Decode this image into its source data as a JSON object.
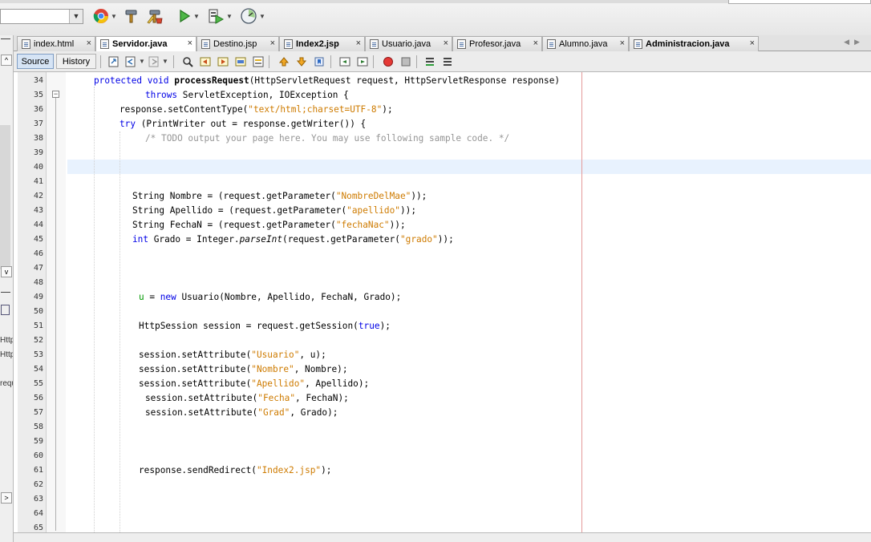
{
  "toolbar": {
    "icons": [
      "chrome-icon",
      "hammer-icon",
      "clean-build-icon",
      "run-icon",
      "debug-icon",
      "profile-icon"
    ]
  },
  "tabs": [
    {
      "label": "index.html",
      "bold": false,
      "active": false
    },
    {
      "label": "Servidor.java",
      "bold": true,
      "active": true
    },
    {
      "label": "Destino.jsp",
      "bold": false,
      "active": false
    },
    {
      "label": "Index2.jsp",
      "bold": true,
      "active": false
    },
    {
      "label": "Usuario.java",
      "bold": false,
      "active": false
    },
    {
      "label": "Profesor.java",
      "bold": false,
      "active": false
    },
    {
      "label": "Alumno.java",
      "bold": false,
      "active": false
    },
    {
      "label": "Administracion.java",
      "bold": true,
      "active": false
    }
  ],
  "tab_close": "×",
  "editor": {
    "source_label": "Source",
    "history_label": "History"
  },
  "left_fragments": [
    "Http",
    "Http",
    "requ"
  ],
  "code": {
    "line_numbers": [
      "34",
      "35",
      "36",
      "37",
      "38",
      "39",
      "40",
      "41",
      "42",
      "43",
      "44",
      "45",
      "46",
      "47",
      "48",
      "49",
      "50",
      "51",
      "52",
      "53",
      "54",
      "55",
      "56",
      "57",
      "58",
      "59",
      "60",
      "61",
      "62",
      "63",
      "64",
      "65"
    ],
    "lines": [
      {
        "n": "34",
        "indent": 117,
        "tokens": [
          [
            "k",
            "protected void "
          ],
          [
            "b",
            "processRequest"
          ],
          [
            "",
            "(HttpServletRequest request, HttpServletResponse response)"
          ]
        ]
      },
      {
        "n": "35",
        "indent": 181,
        "tokens": [
          [
            "k",
            "throws "
          ],
          [
            "",
            "ServletException, IOException {"
          ]
        ]
      },
      {
        "n": "36",
        "indent": 149,
        "tokens": [
          [
            "",
            "response.setContentType("
          ],
          [
            "s",
            "\"text/html;charset=UTF-8\""
          ],
          [
            "",
            ");"
          ]
        ]
      },
      {
        "n": "37",
        "indent": 149,
        "tokens": [
          [
            "k",
            "try "
          ],
          [
            "",
            "(PrintWriter out = response.getWriter()) {"
          ]
        ]
      },
      {
        "n": "38",
        "indent": 181,
        "tokens": [
          [
            "c",
            "/* TODO output your page here. You may use following sample code. */"
          ]
        ]
      },
      {
        "n": "39",
        "indent": 0,
        "tokens": []
      },
      {
        "n": "40",
        "indent": 0,
        "tokens": []
      },
      {
        "n": "41",
        "indent": 0,
        "tokens": []
      },
      {
        "n": "42",
        "indent": 165,
        "tokens": [
          [
            "",
            "String Nombre = (request.getParameter("
          ],
          [
            "s",
            "\"NombreDelMae\""
          ],
          [
            "",
            "));"
          ]
        ]
      },
      {
        "n": "43",
        "indent": 165,
        "tokens": [
          [
            "",
            "String Apellido = (request.getParameter("
          ],
          [
            "s",
            "\"apellido\""
          ],
          [
            "",
            "));"
          ]
        ]
      },
      {
        "n": "44",
        "indent": 165,
        "tokens": [
          [
            "",
            "String FechaN = (request.getParameter("
          ],
          [
            "s",
            "\"fechaNac\""
          ],
          [
            "",
            "));"
          ]
        ]
      },
      {
        "n": "45",
        "indent": 165,
        "tokens": [
          [
            "k",
            "int "
          ],
          [
            "",
            "Grado = Integer."
          ],
          [
            "i",
            "parseInt"
          ],
          [
            "",
            "(request.getParameter("
          ],
          [
            "s",
            "\"grado\""
          ],
          [
            "",
            "));"
          ]
        ]
      },
      {
        "n": "46",
        "indent": 0,
        "tokens": []
      },
      {
        "n": "47",
        "indent": 0,
        "tokens": []
      },
      {
        "n": "48",
        "indent": 0,
        "tokens": []
      },
      {
        "n": "49",
        "indent": 173,
        "tokens": [
          [
            "u",
            "u"
          ],
          [
            "",
            " = "
          ],
          [
            "k",
            "new "
          ],
          [
            "",
            "Usuario(Nombre, Apellido, FechaN, Grado);"
          ]
        ]
      },
      {
        "n": "50",
        "indent": 0,
        "tokens": []
      },
      {
        "n": "51",
        "indent": 173,
        "tokens": [
          [
            "",
            "HttpSession session = request.getSession("
          ],
          [
            "k",
            "true"
          ],
          [
            "",
            ");"
          ]
        ]
      },
      {
        "n": "52",
        "indent": 0,
        "tokens": []
      },
      {
        "n": "53",
        "indent": 173,
        "tokens": [
          [
            "",
            "session.setAttribute("
          ],
          [
            "s",
            "\"Usuario\""
          ],
          [
            "",
            ", u);"
          ]
        ]
      },
      {
        "n": "54",
        "indent": 173,
        "tokens": [
          [
            "",
            "session.setAttribute("
          ],
          [
            "s",
            "\"Nombre\""
          ],
          [
            "",
            ", Nombre);"
          ]
        ]
      },
      {
        "n": "55",
        "indent": 173,
        "tokens": [
          [
            "",
            "session.setAttribute("
          ],
          [
            "s",
            "\"Apellido\""
          ],
          [
            "",
            ", Apellido);"
          ]
        ]
      },
      {
        "n": "56",
        "indent": 181,
        "tokens": [
          [
            "",
            "session.setAttribute("
          ],
          [
            "s",
            "\"Fecha\""
          ],
          [
            "",
            ", FechaN);"
          ]
        ]
      },
      {
        "n": "57",
        "indent": 181,
        "tokens": [
          [
            "",
            "session.setAttribute("
          ],
          [
            "s",
            "\"Grad\""
          ],
          [
            "",
            ", Grado);"
          ]
        ]
      },
      {
        "n": "58",
        "indent": 0,
        "tokens": []
      },
      {
        "n": "59",
        "indent": 0,
        "tokens": []
      },
      {
        "n": "60",
        "indent": 0,
        "tokens": []
      },
      {
        "n": "61",
        "indent": 173,
        "tokens": [
          [
            "",
            "response.sendRedirect("
          ],
          [
            "s",
            "\"Index2.jsp\""
          ],
          [
            "",
            ");"
          ]
        ]
      },
      {
        "n": "62",
        "indent": 0,
        "tokens": []
      },
      {
        "n": "63",
        "indent": 0,
        "tokens": []
      },
      {
        "n": "64",
        "indent": 0,
        "tokens": []
      },
      {
        "n": "65",
        "indent": 0,
        "tokens": []
      }
    ]
  },
  "colors": {
    "keyword": "#0000e6",
    "string": "#ce7b00",
    "comment": "#969696",
    "field": "#009900",
    "current_line": "#e8f2fe",
    "margin": "#e49a9a"
  }
}
